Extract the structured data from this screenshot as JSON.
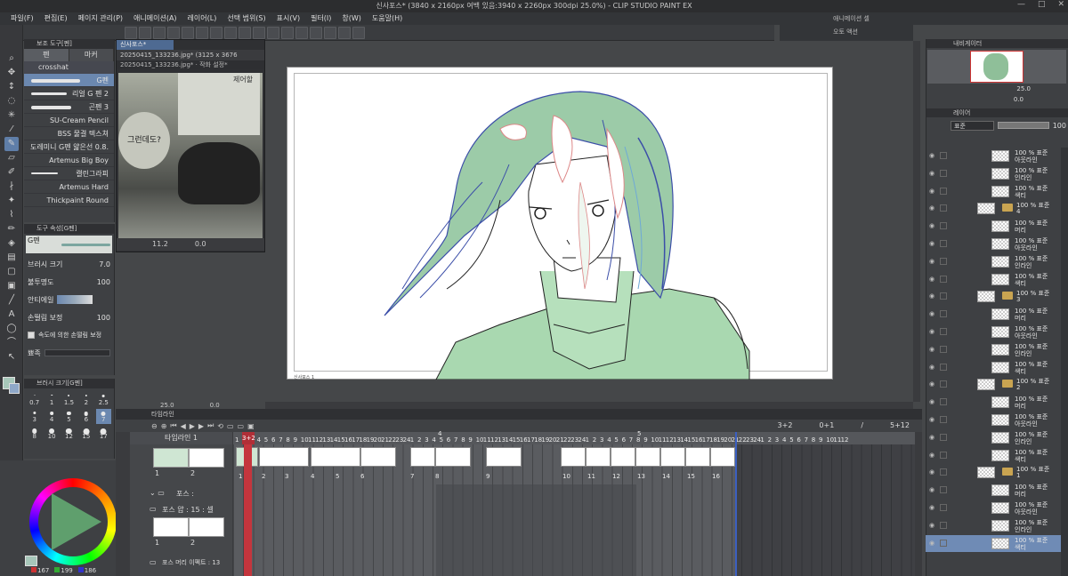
{
  "window": {
    "title": "신사포스* (3840 x 2160px 여백 있음:3940 x 2260px 300dpi 25.0%) - CLIP STUDIO PAINT EX",
    "controls": [
      "—",
      "□",
      "✕"
    ]
  },
  "menu": [
    "파일(F)",
    "편집(E)",
    "페이지 관리(P)",
    "애니메이션(A)",
    "레이어(L)",
    "선택 범위(S)",
    "표시(V)",
    "필터(I)",
    "창(W)",
    "도움말(H)"
  ],
  "right_mid": {
    "item1": "애니메이션 셀",
    "item2": "오토 액션"
  },
  "subtool": {
    "header": "보조 도구[펜]",
    "tabs": [
      "펜",
      "마커"
    ],
    "group": "crosshat",
    "brushes": [
      "G펜",
      "리얼 G 펜 2",
      "곤펜 3",
      "SU-Cream Pencil",
      "BSS 물결 텍스쳐",
      "도레미니 G펜 얇은선 0.8.",
      "Artemus Big Boy",
      "캘린그라피",
      "Artemus Hard",
      "Thickpaint Round"
    ]
  },
  "tool_property": {
    "header": "도구 속성[G펜]",
    "preview_label": "G펜",
    "brush_size_label": "브러시 크기",
    "brush_size_value": "7.0",
    "opacity_label": "불투명도",
    "opacity_value": "100",
    "antialias_label": "안티에일",
    "stabilize_label": "손떨림 보정",
    "stabilize_value": "100",
    "speed_label": "속도에 의한 손떨림 보정",
    "taper_label": "뾰족"
  },
  "brush_size": {
    "header": "브러시 크기[G펜]",
    "sizes": [
      "0.7",
      "1",
      "1.5",
      "2",
      "2.5",
      "3",
      "4",
      "5",
      "6",
      "7",
      "8",
      "10",
      "12",
      "15",
      "17"
    ],
    "selected": "7"
  },
  "color": {
    "r": "167",
    "g": "199",
    "b": "186",
    "main": "#a7c7ba",
    "sub": "#8fa8c8"
  },
  "subwindow": {
    "tab": "신사포스*",
    "file": "20250415_133236.jpg* (3125 x 3676",
    "file2": "20250415_133236.jpg*",
    "file2_extra": "작화 설정*",
    "bubble_text": "그런데도?",
    "top_text": "제어할",
    "zoom": "11.2",
    "rotation": "0.0"
  },
  "canvas": {
    "footer": "신사포스 1",
    "zoom": "25.0",
    "rotation": "0.0",
    "accent_green": "#a9d8b0",
    "line_blue": "#3b4ea8"
  },
  "timeline": {
    "header": "타임라인",
    "name": "타임라인 1",
    "playhead_label": "3+2",
    "info": [
      "3+2",
      "0+1",
      "/",
      "5+12"
    ],
    "ruler": [
      "1",
      "2",
      "3",
      "4",
      "5",
      "6",
      "7",
      "8",
      "9",
      "10",
      "11",
      "12",
      "13",
      "14",
      "15",
      "16",
      "17",
      "18",
      "19",
      "20",
      "21",
      "22",
      "23",
      "24",
      "1",
      "2",
      "3",
      "4",
      "5",
      "6",
      "7",
      "8",
      "9",
      "10",
      "11",
      "12",
      "13",
      "14",
      "15",
      "16",
      "17",
      "18",
      "19",
      "20",
      "21",
      "22",
      "23",
      "24",
      "1",
      "2",
      "3",
      "4",
      "5",
      "6",
      "7",
      "8",
      "9",
      "10",
      "11",
      "12",
      "13",
      "14",
      "15",
      "16",
      "17",
      "18",
      "19",
      "20",
      "21",
      "22",
      "23",
      "24",
      "1",
      "2",
      "3",
      "4",
      "5",
      "6",
      "7",
      "8",
      "9",
      "10",
      "11",
      "12"
    ],
    "second_marks": [
      "4",
      "5"
    ],
    "cels": [
      "1",
      "2",
      "3",
      "4",
      "5",
      "6",
      "7",
      "8",
      "9",
      "10",
      "11",
      "12",
      "13",
      "14",
      "15",
      "16"
    ],
    "rows": [
      "포스 :",
      "포스 얍 : 15 : 셀",
      "포스 머리 이펙트 : 13"
    ],
    "thumb_labels": [
      "1",
      "2",
      "1",
      "2"
    ]
  },
  "navigator": {
    "header": "내비게이터",
    "zoom": "25.0",
    "rotation": "0.0"
  },
  "layers": {
    "header": "레이어",
    "blend": "표준",
    "opacity": "100",
    "items": [
      {
        "type": "layer",
        "top": "100 % 표준",
        "bot": "아웃라인"
      },
      {
        "type": "layer",
        "top": "100 % 표준",
        "bot": "인라인"
      },
      {
        "type": "layer",
        "top": "100 % 표준",
        "bot": "색티"
      },
      {
        "type": "folder",
        "top": "100 % 표준",
        "bot": "4"
      },
      {
        "type": "layer",
        "top": "100 % 표준",
        "bot": "머리"
      },
      {
        "type": "layer",
        "top": "100 % 표준",
        "bot": "아웃라인"
      },
      {
        "type": "layer",
        "top": "100 % 표준",
        "bot": "인라인"
      },
      {
        "type": "layer",
        "top": "100 % 표준",
        "bot": "색티"
      },
      {
        "type": "folder",
        "top": "100 % 표준",
        "bot": "3"
      },
      {
        "type": "layer",
        "top": "100 % 표준",
        "bot": "머리"
      },
      {
        "type": "layer",
        "top": "100 % 표준",
        "bot": "아웃라인"
      },
      {
        "type": "layer",
        "top": "100 % 표준",
        "bot": "인라인"
      },
      {
        "type": "layer",
        "top": "100 % 표준",
        "bot": "색티"
      },
      {
        "type": "folder",
        "top": "100 % 표준",
        "bot": "2"
      },
      {
        "type": "layer",
        "top": "100 % 표준",
        "bot": "머리"
      },
      {
        "type": "layer",
        "top": "100 % 표준",
        "bot": "아웃라인"
      },
      {
        "type": "layer",
        "top": "100 % 표준",
        "bot": "인라인"
      },
      {
        "type": "layer",
        "top": "100 % 표준",
        "bot": "색티"
      },
      {
        "type": "folder",
        "top": "100 % 표준",
        "bot": "1"
      },
      {
        "type": "layer",
        "top": "100 % 표준",
        "bot": "머리"
      },
      {
        "type": "layer",
        "top": "100 % 표준",
        "bot": "아웃라인"
      },
      {
        "type": "layer",
        "top": "100 % 표준",
        "bot": "인라인"
      },
      {
        "type": "layer",
        "top": "100 % 표준",
        "bot": "색티",
        "selected": true
      }
    ]
  }
}
